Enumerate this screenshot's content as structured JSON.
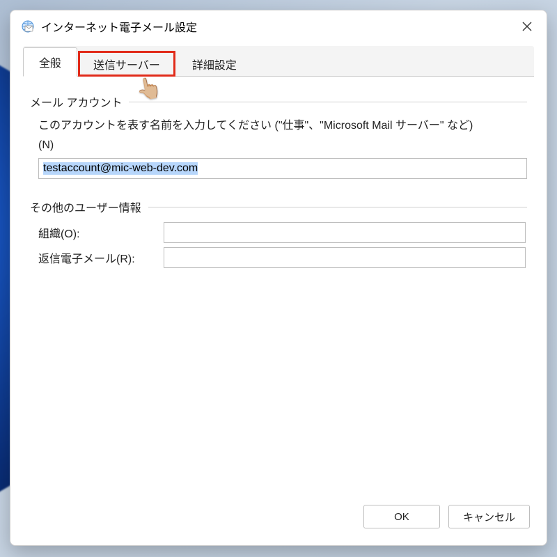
{
  "window": {
    "title": "インターネット電子メール設定"
  },
  "tabs": {
    "general": "全般",
    "outgoing": "送信サーバー",
    "advanced": "詳細設定"
  },
  "group1": {
    "header": "メール アカウント",
    "desc1": "このアカウントを表す名前を入力してください (\"仕事\"、\"Microsoft Mail サーバー\" など)",
    "desc2": "(N)",
    "value": "testaccount@mic-web-dev.com"
  },
  "group2": {
    "header": "その他のユーザー情報",
    "org_label": "組織(O):",
    "org_value": "",
    "reply_label": "返信電子メール(R):",
    "reply_value": ""
  },
  "buttons": {
    "ok": "OK",
    "cancel": "キャンセル"
  }
}
